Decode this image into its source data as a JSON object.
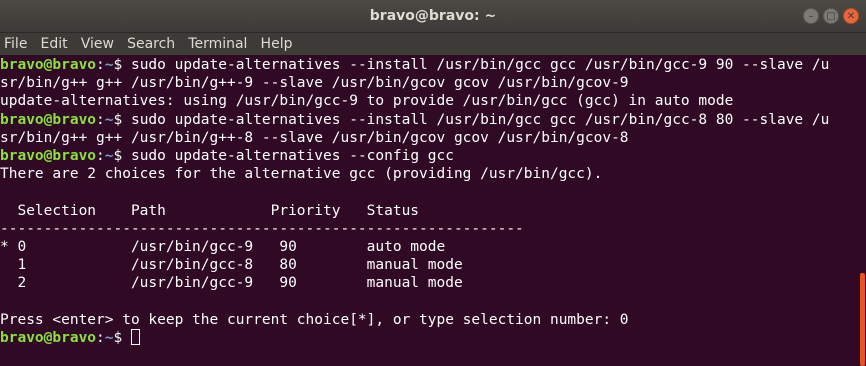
{
  "window": {
    "title": "bravo@bravo: ~",
    "buttons": {
      "minimize": "–",
      "maximize": "□",
      "close": "✕"
    }
  },
  "menu": [
    "File",
    "Edit",
    "View",
    "Search",
    "Terminal",
    "Help"
  ],
  "prompt": {
    "user_host": "bravo@bravo",
    "sep": ":",
    "path": "~",
    "symbol": "$ "
  },
  "lines": [
    {
      "type": "prompt",
      "cmd": "sudo update-alternatives --install /usr/bin/gcc gcc /usr/bin/gcc-9 90 --slave /u"
    },
    {
      "type": "text",
      "text": "sr/bin/g++ g++ /usr/bin/g++-9 --slave /usr/bin/gcov gcov /usr/bin/gcov-9"
    },
    {
      "type": "text",
      "text": "update-alternatives: using /usr/bin/gcc-9 to provide /usr/bin/gcc (gcc) in auto mode"
    },
    {
      "type": "prompt",
      "cmd": "sudo update-alternatives --install /usr/bin/gcc gcc /usr/bin/gcc-8 80 --slave /u"
    },
    {
      "type": "text",
      "text": "sr/bin/g++ g++ /usr/bin/g++-8 --slave /usr/bin/gcov gcov /usr/bin/gcov-8"
    },
    {
      "type": "prompt",
      "cmd": "sudo update-alternatives --config gcc"
    },
    {
      "type": "text",
      "text": "There are 2 choices for the alternative gcc (providing /usr/bin/gcc)."
    },
    {
      "type": "text",
      "text": ""
    },
    {
      "type": "text",
      "text": "  Selection    Path            Priority   Status"
    },
    {
      "type": "text",
      "text": "------------------------------------------------------------"
    },
    {
      "type": "text",
      "text": "* 0            /usr/bin/gcc-9   90        auto mode"
    },
    {
      "type": "text",
      "text": "  1            /usr/bin/gcc-8   80        manual mode"
    },
    {
      "type": "text",
      "text": "  2            /usr/bin/gcc-9   90        manual mode"
    },
    {
      "type": "text",
      "text": ""
    },
    {
      "type": "text",
      "text": "Press <enter> to keep the current choice[*], or type selection number: 0"
    },
    {
      "type": "prompt_cursor",
      "cmd": ""
    }
  ]
}
